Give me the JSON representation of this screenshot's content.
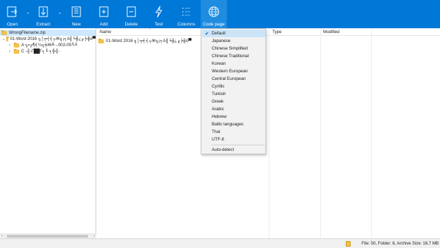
{
  "toolbar": {
    "open": "Open",
    "extract": "Extract",
    "new": "New",
    "add": "Add",
    "delete": "Delete",
    "test": "Test",
    "columns": "Columns",
    "code_page": "Code page"
  },
  "tree": {
    "root": "WrongFilename.zip",
    "child1": "01-Word 2016 ╗│╤╡╡┬Ж╗¡╕ö╢╘╫¿╓╞╫ö▀",
    "grand1": "A ╗▪╔¶╡¼╗╪Ж╩ -.002-05╙╨",
    "grand2": "C -╢-Г██Г╕╙ ╕╬╢-"
  },
  "columns": {
    "name": "Name",
    "type": "Type",
    "modified": "Modified"
  },
  "files": [
    {
      "name": "01-Word 2016 ╗│╤╡╡┬Ж╗¡╕ö╢╘╫¿╓╞╫ö▀"
    }
  ],
  "code_page_menu": {
    "items": [
      {
        "label": "Default",
        "checked": true
      },
      {
        "label": "Japanese"
      },
      {
        "label": "Chinese Simplified"
      },
      {
        "label": "Chinese Traditional"
      },
      {
        "label": "Korean"
      },
      {
        "label": "Western European"
      },
      {
        "label": "Central European"
      },
      {
        "label": "Cyrillic"
      },
      {
        "label": "Turkish"
      },
      {
        "label": "Greek"
      },
      {
        "label": "Arabic"
      },
      {
        "label": "Hebrew"
      },
      {
        "label": "Baltic languages"
      },
      {
        "label": "Thai"
      },
      {
        "label": "UTF-8"
      }
    ],
    "auto_detect": "Auto-detect"
  },
  "status": {
    "text": "File: 50, Folder: 6, Archive Size: 16.7 MB"
  },
  "colors": {
    "toolbar": "#0078d7",
    "menu_bg": "#f2f2f2",
    "selection": "#cde8ff"
  }
}
